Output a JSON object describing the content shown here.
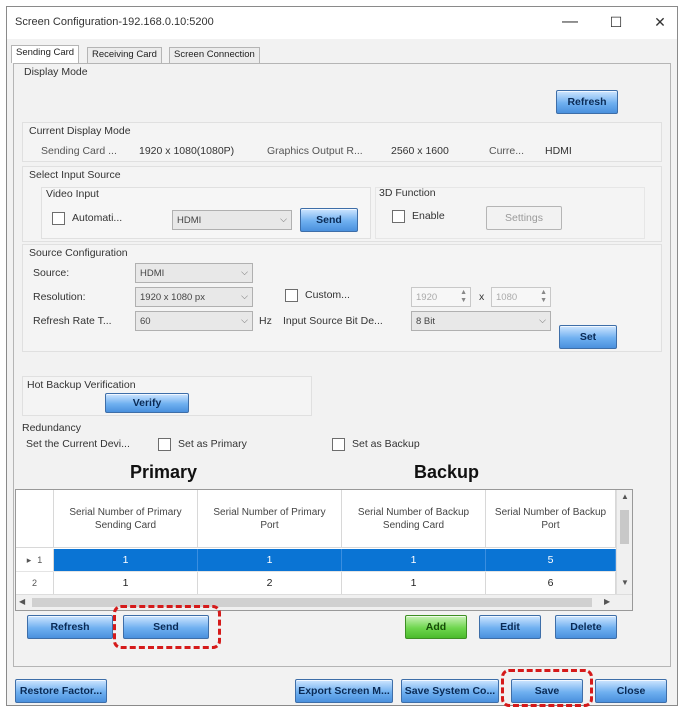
{
  "window": {
    "title": "Screen Configuration-192.168.0.10:5200",
    "controls": {
      "minimize": "—",
      "maximize": "☐",
      "close": "✕"
    }
  },
  "tabs": [
    {
      "label": "Sending Card",
      "active": true
    },
    {
      "label": "Receiving Card",
      "active": false
    },
    {
      "label": "Screen Connection",
      "active": false
    }
  ],
  "display_mode": {
    "label": "Display Mode",
    "refresh_label": "Refresh",
    "current_label": "Current Display Mode",
    "sending_card_label": "Sending Card ...",
    "sending_card_value": "1920 x 1080(1080P)",
    "graphics_label": "Graphics Output R...",
    "graphics_value": "2560 x 1600",
    "current_label_short": "Curre...",
    "current_value": "HDMI"
  },
  "input_source": {
    "label": "Select Input Source",
    "video_input_label": "Video Input",
    "auto_label": "Automati...",
    "video_select_value": "HDMI",
    "send_label": "Send",
    "function3d_label": "3D Function",
    "enable_label": "Enable",
    "settings_label": "Settings"
  },
  "source_config": {
    "label": "Source Configuration",
    "source_label": "Source:",
    "source_value": "HDMI",
    "resolution_label": "Resolution:",
    "resolution_value": "1920 x 1080 px",
    "custom_label": "Custom...",
    "width_value": "1920",
    "x_label": "x",
    "height_value": "1080",
    "refresh_label": "Refresh Rate T...",
    "refresh_value": "60",
    "hz_label": "Hz",
    "bitdepth_label": "Input Source Bit De...",
    "bitdepth_value": "8 Bit",
    "set_label": "Set"
  },
  "hot_backup": {
    "label": "Hot Backup Verification",
    "verify_label": "Verify"
  },
  "redundancy": {
    "label": "Redundancy",
    "set_current_label": "Set the Current Devi...",
    "set_primary_label": "Set as Primary",
    "set_backup_label": "Set as Backup",
    "primary_heading": "Primary",
    "backup_heading": "Backup",
    "columns": [
      "Serial Number of Primary Sending Card",
      "Serial Number of Primary Port",
      "Serial Number of Backup Sending Card",
      "Serial Number of Backup Port"
    ],
    "rows": [
      {
        "marker": "▸",
        "index": "1",
        "cells": [
          "1",
          "1",
          "1",
          "5"
        ],
        "selected": true
      },
      {
        "marker": "",
        "index": "2",
        "cells": [
          "1",
          "2",
          "1",
          "6"
        ],
        "selected": false
      }
    ],
    "refresh_label": "Refresh",
    "send_label": "Send",
    "add_label": "Add",
    "edit_label": "Edit",
    "delete_label": "Delete"
  },
  "footer": {
    "restore_label": "Restore Factor...",
    "export_label": "Export Screen M...",
    "save_system_label": "Save System Co...",
    "save_label": "Save",
    "close_label": "Close"
  },
  "colors": {
    "accent_blue": "#0a74d4",
    "highlight_red": "#d51a1a",
    "add_green": "#6ed64e"
  }
}
